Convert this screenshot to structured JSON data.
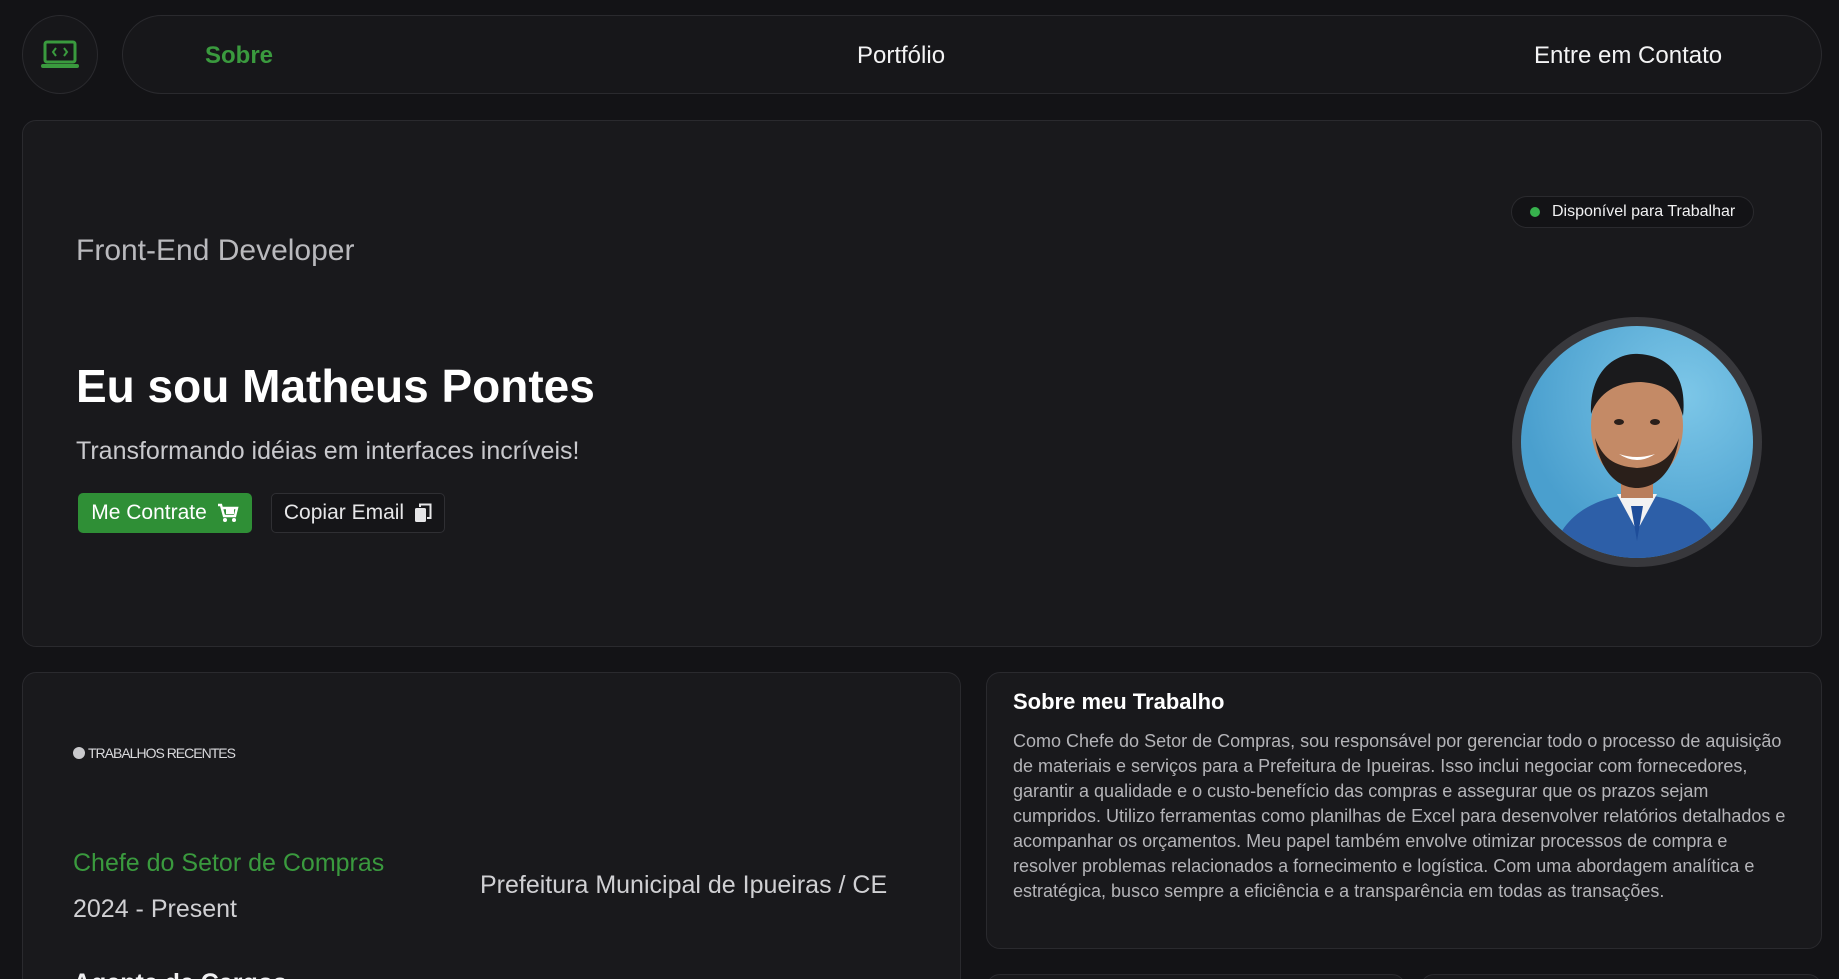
{
  "header": {
    "logo_icon": "laptop-code-icon",
    "nav": {
      "about": "Sobre",
      "portfolio": "Portfólio",
      "contact": "Entre em Contato"
    }
  },
  "hero": {
    "role": "Front-End Developer",
    "headline": "Eu sou Matheus Pontes",
    "tagline": "Transformando idéias em interfaces incríveis!",
    "hire_label": "Me Contrate",
    "hire_icon": "cart-icon",
    "copy_label": "Copiar Email",
    "copy_icon": "copy-icon",
    "status": "Disponível para Trabalhar",
    "status_color": "#37b24d"
  },
  "experience": {
    "section_label": "TRABALHOS RECENTES",
    "jobs": [
      {
        "title": "Chefe do Setor de Compras",
        "period": "2024 - Present",
        "company": "Prefeitura Municipal de Ipueiras / CE"
      },
      {
        "title": "Agente de Cargos"
      }
    ]
  },
  "about": {
    "title": "Sobre meu Trabalho",
    "text": "Como Chefe do Setor de Compras, sou responsável por gerenciar todo o processo de aquisição de materiais e serviços para a Prefeitura de Ipueiras. Isso inclui negociar com fornecedores, garantir a qualidade e o custo-benefício das compras e assegurar que os prazos sejam cumpridos. Utilizo ferramentas como planilhas de Excel para desenvolver relatórios detalhados e acompanhar os orçamentos. Meu papel também envolve otimizar processos de compra e resolver problemas relacionados a fornecimento e logística. Com uma abordagem analítica e estratégica, busco sempre a eficiência e a transparência em todas as transações."
  },
  "colors": {
    "accent": "#3a9a3e",
    "background": "#131316",
    "card": "#19191c"
  }
}
